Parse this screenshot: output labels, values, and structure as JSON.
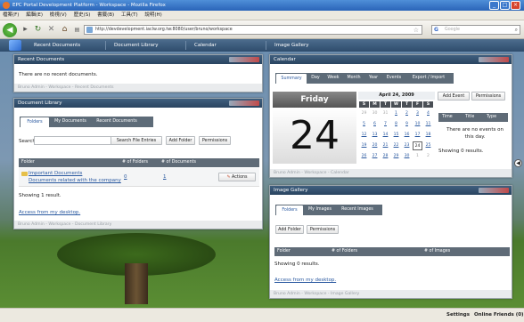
{
  "window": {
    "title": "EPC Portal Development Platform - Workspace - Mozilla Firefox"
  },
  "menu": [
    "檔案(F)",
    "編輯(E)",
    "檢視(V)",
    "歷史(S)",
    "書籤(B)",
    "工具(T)",
    "說明(H)"
  ],
  "browser": {
    "url": "http://devdevelopment.iaclw.org.tw:8080/user/bruno/workspace",
    "search_engine": "G",
    "search_placeholder": "Google"
  },
  "portal_nav": [
    "Recent Documents",
    "Document Library",
    "Calendar",
    "Image Gallery"
  ],
  "recent_documents": {
    "title": "Recent Documents",
    "empty_text": "There are no recent documents.",
    "footer": "Bruno Admin - Workspace - Recent Documents"
  },
  "document_library": {
    "title": "Document Library",
    "tabs": [
      "Folders",
      "My Documents",
      "Recent Documents"
    ],
    "search_label": "Search",
    "search_value": "",
    "buttons": {
      "search": "Search File Entries",
      "add_folder": "Add Folder",
      "permissions": "Permissions"
    },
    "columns": [
      "Folder",
      "# of Folders",
      "# of Documents"
    ],
    "rows": [
      {
        "name": "Important Documents",
        "description": "Documents related with the company",
        "folders": "0",
        "documents": "1",
        "action": "Actions"
      }
    ],
    "showing": "Showing 1 result.",
    "desktop_link": "Access from my desktop.",
    "footer": "Bruno Admin - Workspace - Document Library"
  },
  "calendar": {
    "title": "Calendar",
    "tabs": [
      "Summary",
      "Day",
      "Week",
      "Month",
      "Year",
      "Events",
      "Export / Import"
    ],
    "day_name": "Friday",
    "day_number": "24",
    "month_title": "April 24, 2009",
    "weekdays": [
      "S",
      "M",
      "T",
      "W",
      "T",
      "F",
      "S"
    ],
    "weeks": [
      [
        "29",
        "30",
        "31",
        "1",
        "2",
        "3",
        "4"
      ],
      [
        "5",
        "6",
        "7",
        "8",
        "9",
        "10",
        "11"
      ],
      [
        "12",
        "13",
        "14",
        "15",
        "16",
        "17",
        "18"
      ],
      [
        "19",
        "20",
        "21",
        "22",
        "23",
        "24",
        "25"
      ],
      [
        "26",
        "27",
        "28",
        "29",
        "30",
        "1",
        "2"
      ]
    ],
    "buttons": {
      "add_event": "Add Event",
      "permissions": "Permissions"
    },
    "events_columns": [
      "Time",
      "Title",
      "Type"
    ],
    "no_events": "There are no events on this day.",
    "showing": "Showing 0 results.",
    "footer": "Bruno Admin - Workspace - Calendar"
  },
  "image_gallery": {
    "title": "Image Gallery",
    "tabs": [
      "Folders",
      "My Images",
      "Recent Images"
    ],
    "buttons": {
      "add_folder": "Add Folder",
      "permissions": "Permissions"
    },
    "columns": [
      "Folder",
      "# of Folders",
      "# of Images"
    ],
    "showing": "Showing 0 results.",
    "desktop_link": "Access from my desktop.",
    "footer": "Bruno Admin - Workspace - Image Gallery"
  },
  "dock": {
    "settings": "Settings",
    "online_friends": "Online Friends (0)"
  }
}
